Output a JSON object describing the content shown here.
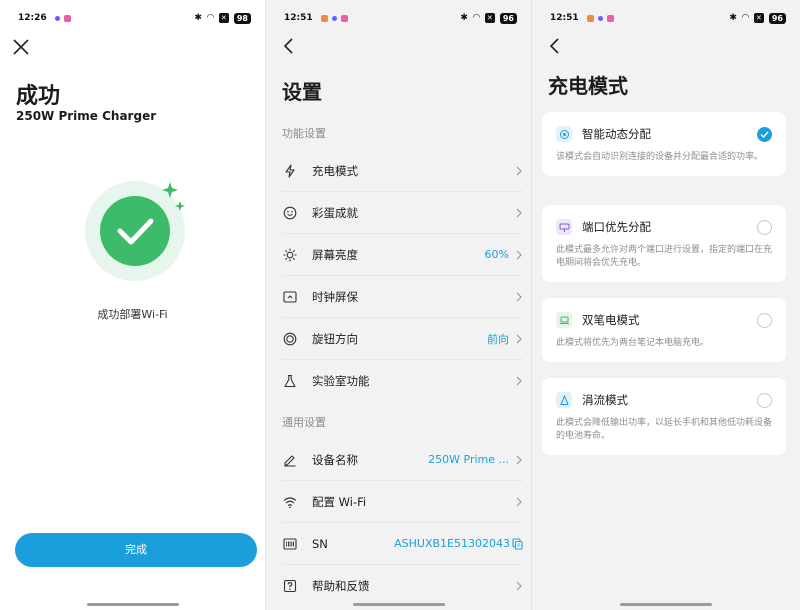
{
  "screen1": {
    "status": {
      "time": "12:26",
      "battery": "98"
    },
    "title": "成功",
    "subtitle": "250W Prime Charger",
    "success_text": "成功部署Wi-Fi",
    "done_label": "完成"
  },
  "screen2": {
    "status": {
      "time": "12:51",
      "battery": "96"
    },
    "title": "设置",
    "section_function": "功能设置",
    "section_general": "通用设置",
    "items": [
      {
        "label": "充电模式",
        "value": "",
        "icon": "lightning-icon"
      },
      {
        "label": "彩蛋成就",
        "value": "",
        "icon": "smiley-icon"
      },
      {
        "label": "屏幕亮度",
        "value": "60%",
        "icon": "sun-icon"
      },
      {
        "label": "时钟屏保",
        "value": "",
        "icon": "clock-screensaver-icon"
      },
      {
        "label": "旋钮方向",
        "value": "前向",
        "icon": "knob-icon"
      },
      {
        "label": "实验室功能",
        "value": "",
        "icon": "flask-icon"
      }
    ],
    "general_items": [
      {
        "label": "设备名称",
        "value": "250W Prime ...",
        "icon": "edit-icon"
      },
      {
        "label": "配置 Wi-Fi",
        "value": "",
        "icon": "wifi-icon"
      },
      {
        "label": "SN",
        "value": "ASHUXB1E51302043",
        "icon": "barcode-icon"
      },
      {
        "label": "帮助和反馈",
        "value": "",
        "icon": "help-icon"
      }
    ]
  },
  "screen3": {
    "status": {
      "time": "12:51",
      "battery": "96"
    },
    "title": "充电模式",
    "modes": [
      {
        "name": "智能动态分配",
        "desc": "该模式会自动识别连接的设备并分配最合适的功率。",
        "selected": true,
        "icon": "smart-allocation-icon"
      },
      {
        "name": "端口优先分配",
        "desc": "此模式最多允许对两个端口进行设置，指定的端口在充电期间将会优先充电。",
        "selected": false,
        "icon": "port-priority-icon"
      },
      {
        "name": "双笔电模式",
        "desc": "此模式将优先为两台笔记本电脑充电。",
        "selected": false,
        "icon": "dual-laptop-icon"
      },
      {
        "name": "涓流模式",
        "desc": "此模式会降低输出功率，以延长手机和其他低功耗设备的电池寿命。",
        "selected": false,
        "icon": "trickle-icon"
      }
    ]
  },
  "colors": {
    "accent": "#1a9fdc",
    "success": "#3dbb6a",
    "success_bg": "#e7f6ec"
  }
}
